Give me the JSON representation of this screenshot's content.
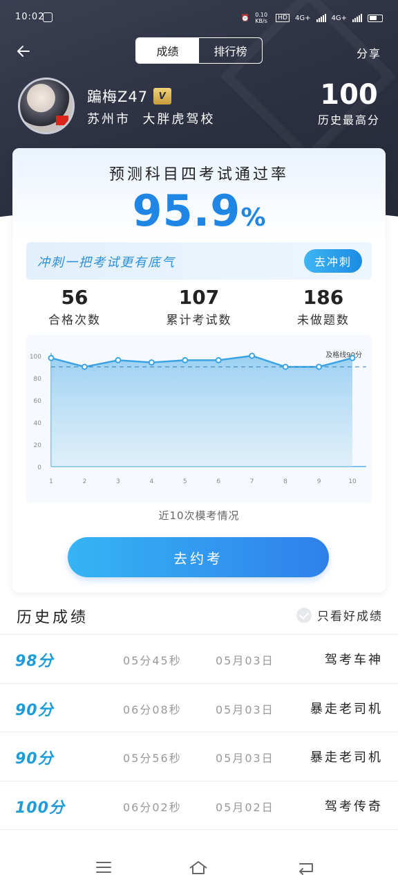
{
  "status": {
    "time": "10:02",
    "net_speed": "0.10 KB/s",
    "hd": "HD",
    "net1": "4G+",
    "net2": "4G+",
    "battery": "81"
  },
  "nav": {
    "tabs": [
      "成绩",
      "排行榜"
    ],
    "active_tab": 0,
    "share_label": "分享"
  },
  "profile": {
    "name": "蹁梅Z47",
    "vip_badge": "V",
    "city": "苏州市",
    "school": "大胖虎驾校",
    "best_score": "100",
    "best_label": "历史最高分"
  },
  "prediction": {
    "title": "预测科目四考试通过率",
    "value": "95.9",
    "unit": "%"
  },
  "banner": {
    "text": "冲刺一把考试更有底气",
    "button": "去冲刺"
  },
  "stats": [
    {
      "value": "56",
      "label": "合格次数"
    },
    {
      "value": "107",
      "label": "累计考试数"
    },
    {
      "value": "186",
      "label": "未做题数"
    }
  ],
  "chart_data": {
    "type": "area",
    "x": [
      1,
      2,
      3,
      4,
      5,
      6,
      7,
      8,
      9,
      10
    ],
    "values": [
      98,
      90,
      96,
      94,
      96,
      96,
      100,
      90,
      90,
      98
    ],
    "y_ticks": [
      0,
      20,
      40,
      60,
      80,
      100
    ],
    "ylim": [
      0,
      100
    ],
    "threshold": {
      "value": 90,
      "label": "及格线90分"
    },
    "grid": false,
    "color": "#3aa3e3",
    "caption": "近10次模考情况"
  },
  "cta": {
    "label": "去约考"
  },
  "history": {
    "title": "历史成绩",
    "filter_label": "只看好成绩",
    "rows": [
      {
        "score": "98分",
        "duration": "05分45秒",
        "date": "05月03日",
        "title": "驾考车神"
      },
      {
        "score": "90分",
        "duration": "06分08秒",
        "date": "05月03日",
        "title": "暴走老司机"
      },
      {
        "score": "90分",
        "duration": "05分56秒",
        "date": "05月03日",
        "title": "暴走老司机"
      },
      {
        "score": "100分",
        "duration": "06分02秒",
        "date": "05月02日",
        "title": "驾考传奇"
      }
    ]
  },
  "system_nav": {
    "icons": [
      "menu-icon",
      "home-icon",
      "back-icon"
    ]
  }
}
